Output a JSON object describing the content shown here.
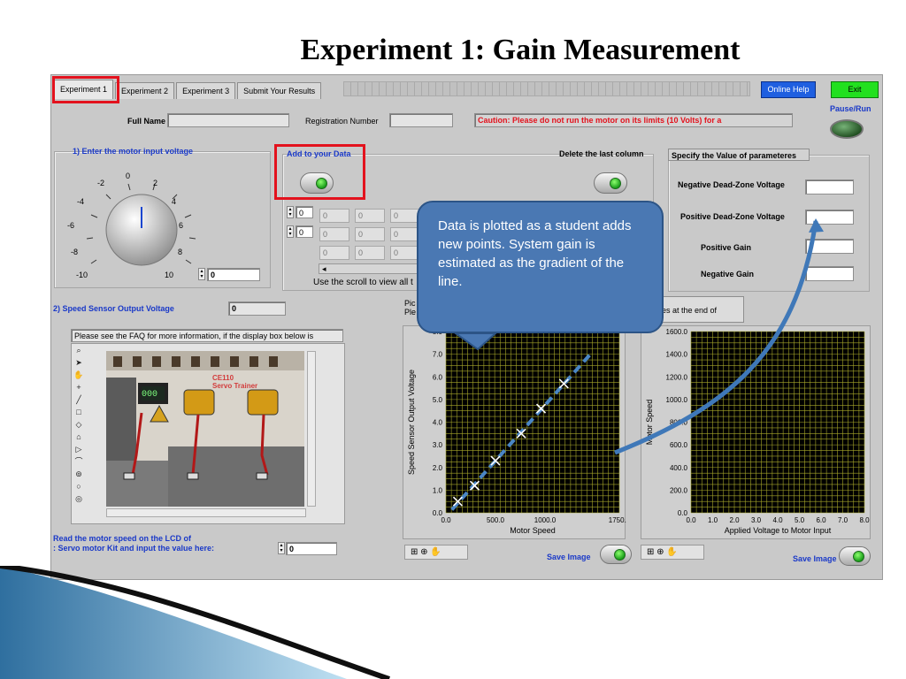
{
  "slide": {
    "title": "Experiment 1: Gain Measurement"
  },
  "tabs": [
    {
      "label": "Experiment 1",
      "active": true
    },
    {
      "label": "Experiment 2",
      "active": false
    },
    {
      "label": "Experiment 3",
      "active": false
    },
    {
      "label": "Submit Your Results",
      "active": false
    }
  ],
  "header": {
    "online_help": "Online Help",
    "exit": "Exit",
    "pause_run": "Pause/Run",
    "full_name_label": "Full Name",
    "full_name_value": "",
    "reg_label": "Registration Number",
    "reg_value": "",
    "caution": "Caution: Please do not run the motor on its limits (10 Volts) for a"
  },
  "voltage": {
    "heading": "1) Enter the motor input voltage",
    "ticks": [
      "-10",
      "-8",
      "-6",
      "-4",
      "-2",
      "0",
      "2",
      "4",
      "6",
      "8",
      "10"
    ],
    "value": "0"
  },
  "data_section": {
    "add_label": "Add to your Data",
    "delete_label": "Delete the last column",
    "index_a": "0",
    "index_b": "0",
    "cells": [
      [
        "0",
        "0",
        "0"
      ],
      [
        "0",
        "0",
        "0"
      ],
      [
        "0",
        "0",
        "0"
      ]
    ],
    "scroll_hint": "Use the scroll to view all t",
    "scroll_left": "◂"
  },
  "params": {
    "heading": "Specify the Value of parameteres",
    "neg_deadzone": "Negative Dead-Zone Voltage",
    "pos_deadzone": "Positive Dead-Zone Voltage",
    "pos_gain": "Positive Gain",
    "neg_gain": "Negative Gain",
    "neg_deadzone_value": "",
    "pos_deadzone_value": "",
    "pos_gain_value": "",
    "neg_gain_value": ""
  },
  "speed_sensor": {
    "label": "2) Speed Sensor Output Voltage",
    "value": "0"
  },
  "video": {
    "faq": "Please see the FAQ for more information, if the display box below is",
    "logo_line1": "CE110",
    "logo_line2": "Servo Trainer",
    "led_display": "000"
  },
  "lcd": {
    "line1": "Read the motor speed on the LCD of",
    "line2": ": Servo motor Kit and input the value here:",
    "value": "0"
  },
  "graph_notes": {
    "left_line1": "Pic",
    "left_line2": "Ple",
    "right": "es at the end of"
  },
  "save_left": "Save Image",
  "save_right": "Save Image",
  "callout": {
    "text": "Data is plotted as a student adds new points. System gain is estimated as the gradient of the line."
  },
  "colors": {
    "callout_fill": "#4a78b3",
    "highlight": "#e3121d",
    "grid": "#a7a72a",
    "plot_bg": "#000000",
    "label_blue": "#1a39c8"
  },
  "chart_data": [
    {
      "type": "scatter",
      "title": "",
      "xlabel": "Motor Speed",
      "ylabel": "Speed Sensor Output Voltage",
      "xlim": [
        0,
        1750
      ],
      "ylim": [
        0,
        8
      ],
      "x_ticks": [
        "0.0",
        "500.0",
        "1000.0",
        "1750.0"
      ],
      "y_ticks": [
        "0.0",
        "1.0",
        "2.0",
        "3.0",
        "4.0",
        "5.0",
        "6.0",
        "7.0",
        "8.0"
      ],
      "grid": true,
      "series": [
        {
          "values": [
            {
              "x": 120,
              "y": 0.5
            },
            {
              "x": 290,
              "y": 1.2
            },
            {
              "x": 500,
              "y": 2.3
            },
            {
              "x": 760,
              "y": 3.5
            },
            {
              "x": 960,
              "y": 4.6
            },
            {
              "x": 1190,
              "y": 5.7
            }
          ]
        }
      ]
    },
    {
      "type": "line",
      "title": "",
      "xlabel": "Applied Voltage to Motor Input",
      "ylabel": "Motor Speed",
      "xlim": [
        0,
        8
      ],
      "ylim": [
        0,
        1600
      ],
      "x_ticks": [
        "0.0",
        "1.0",
        "2.0",
        "3.0",
        "4.0",
        "5.0",
        "6.0",
        "7.0",
        "8.0"
      ],
      "y_ticks": [
        "0.0",
        "200.0",
        "400.0",
        "600.0",
        "800.0",
        "1000.0",
        "1200.0",
        "1400.0",
        "1600.0"
      ],
      "grid": true,
      "series": []
    }
  ]
}
